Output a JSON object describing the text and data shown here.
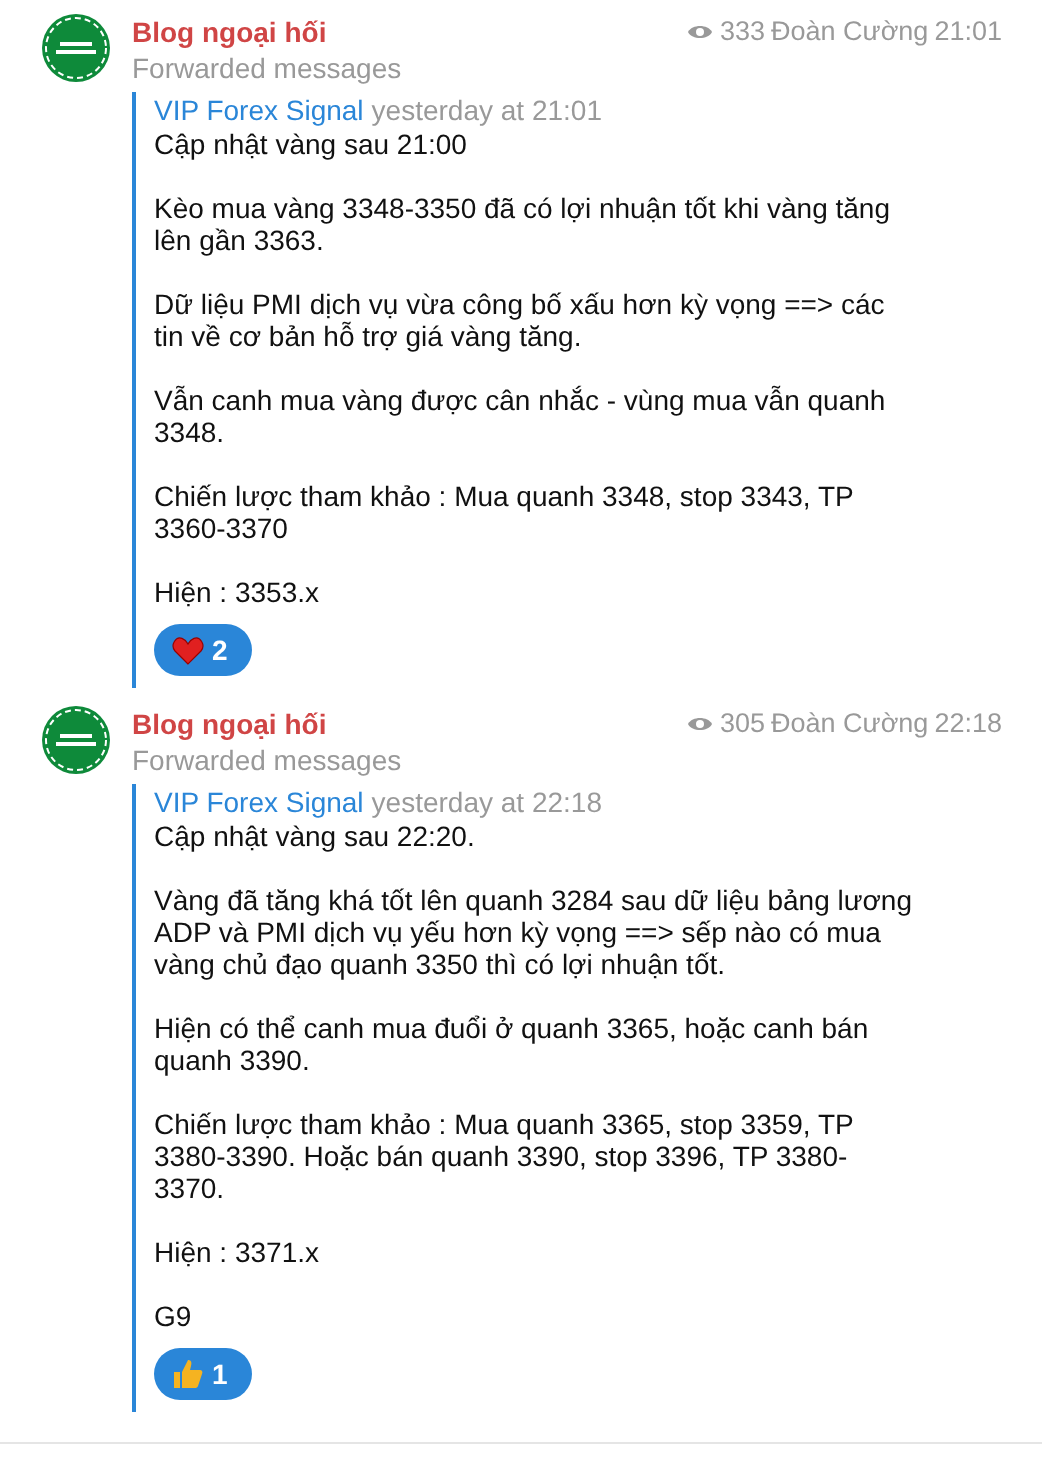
{
  "messages": [
    {
      "channel": "Blog ngoại hối",
      "subtitle": "Forwarded messages",
      "views": "333",
      "author": "Đoàn Cường",
      "time": "21:01",
      "source": "VIP Forex Signal",
      "source_time": "yesterday at 21:01",
      "paragraphs": [
        "Cập nhật vàng sau 21:00",
        "Kèo mua vàng 3348-3350 đã có lợi nhuận tốt khi vàng tăng lên gần 3363.",
        "Dữ liệu PMI dịch vụ vừa công bố xấu hơn kỳ vọng ==> các tin về cơ bản hỗ trợ giá vàng tăng.",
        "Vẫn canh mua vàng được cân nhắc - vùng mua vẫn quanh 3348.",
        "Chiến lược tham khảo : Mua quanh 3348, stop 3343, TP 3360-3370",
        "Hiện : 3353.x"
      ],
      "reaction": {
        "kind": "heart",
        "count": "2"
      }
    },
    {
      "channel": "Blog ngoại hối",
      "subtitle": "Forwarded messages",
      "views": "305",
      "author": "Đoàn Cường",
      "time": "22:18",
      "source": "VIP Forex Signal",
      "source_time": "yesterday at 22:18",
      "paragraphs": [
        "Cập nhật vàng sau 22:20.",
        "Vàng đã tăng khá tốt lên quanh 3284 sau dữ liệu bảng lương ADP và PMI dịch vụ yếu hơn kỳ vọng ==> sếp nào có mua vàng chủ đạo quanh 3350 thì có lợi nhuận tốt.",
        "Hiện có thể canh mua đuổi ở quanh 3365, hoặc canh bán quanh 3390.",
        "Chiến lược tham khảo : Mua quanh 3365, stop 3359, TP 3380-3390. Hoặc bán quanh 3390, stop 3396, TP 3380-3370.",
        "Hiện : 3371.x",
        "G9"
      ],
      "reaction": {
        "kind": "thumbs",
        "count": "1"
      }
    }
  ]
}
